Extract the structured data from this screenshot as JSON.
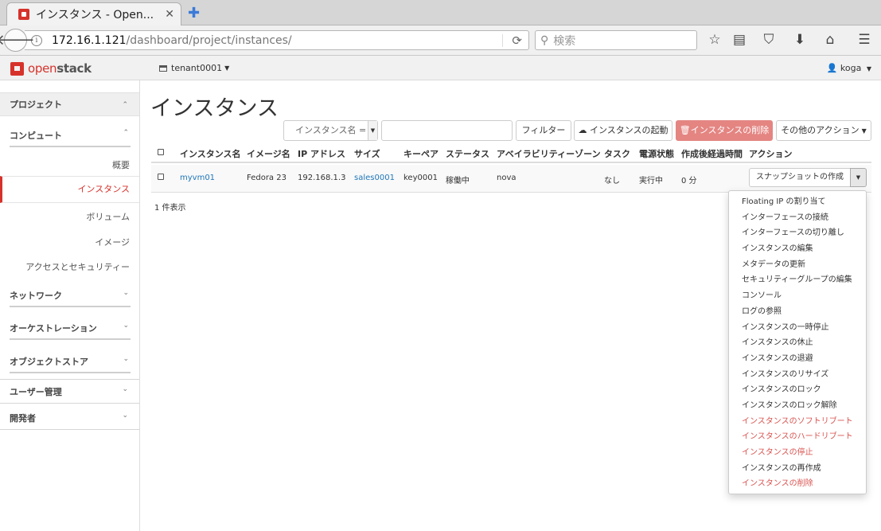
{
  "browser": {
    "tab_title": "インスタンス - Open...",
    "tab_close": "✕",
    "new_tab": "✚",
    "url_host": "172.16.1.121",
    "url_path": "/dashboard/project/instances/",
    "search_placeholder": "検索"
  },
  "header": {
    "logo_part1": "open",
    "logo_part2": "stack",
    "tenant": "tenant0001",
    "user": "koga"
  },
  "sidebar": {
    "project": "プロジェクト",
    "compute": "コンピュート",
    "items": [
      "概要",
      "インスタンス",
      "ボリューム",
      "イメージ",
      "アクセスとセキュリティー"
    ],
    "network": "ネットワーク",
    "orchestration": "オーケストレーション",
    "object_store": "オブジェクトストア",
    "user_admin": "ユーザー管理",
    "developer": "開発者"
  },
  "main": {
    "title": "インスタンス",
    "filter_select": "インスタンス名 =",
    "btn_filter": "フィルター",
    "btn_launch": "インスタンスの起動",
    "btn_delete": "インスタンスの削除",
    "btn_more": "その他のアクション",
    "columns": [
      "インスタンス名",
      "イメージ名",
      "IP アドレス",
      "サイズ",
      "キーペア",
      "ステータス",
      "アベイラビリティーゾーン",
      "タスク",
      "電源状態",
      "作成後経過時間",
      "アクション"
    ],
    "rows": [
      {
        "name": "myvm01",
        "image": "Fedora 23",
        "ip": "192.168.1.3",
        "size": "sales0001",
        "keypair": "key0001",
        "status": "稼働中",
        "zone": "nova",
        "task": "なし",
        "power": "実行中",
        "age": "0 分",
        "action": "スナップショットの作成"
      }
    ],
    "count": "1 件表示"
  },
  "action_menu": [
    {
      "label": "Floating IP の割り当て",
      "danger": false
    },
    {
      "label": "インターフェースの接続",
      "danger": false
    },
    {
      "label": "インターフェースの切り離し",
      "danger": false
    },
    {
      "label": "インスタンスの編集",
      "danger": false
    },
    {
      "label": "メタデータの更新",
      "danger": false
    },
    {
      "label": "セキュリティーグループの編集",
      "danger": false
    },
    {
      "label": "コンソール",
      "danger": false
    },
    {
      "label": "ログの参照",
      "danger": false
    },
    {
      "label": "インスタンスの一時停止",
      "danger": false
    },
    {
      "label": "インスタンスの休止",
      "danger": false
    },
    {
      "label": "インスタンスの退避",
      "danger": false
    },
    {
      "label": "インスタンスのリサイズ",
      "danger": false
    },
    {
      "label": "インスタンスのロック",
      "danger": false
    },
    {
      "label": "インスタンスのロック解除",
      "danger": false
    },
    {
      "label": "インスタンスのソフトリブート",
      "danger": true
    },
    {
      "label": "インスタンスのハードリブート",
      "danger": true
    },
    {
      "label": "インスタンスの停止",
      "danger": true
    },
    {
      "label": "インスタンスの再作成",
      "danger": false
    },
    {
      "label": "インスタンスの削除",
      "danger": true
    }
  ],
  "colors": {
    "brand": "#d6322b",
    "link": "#1f76b8",
    "danger": "#d9534f"
  }
}
